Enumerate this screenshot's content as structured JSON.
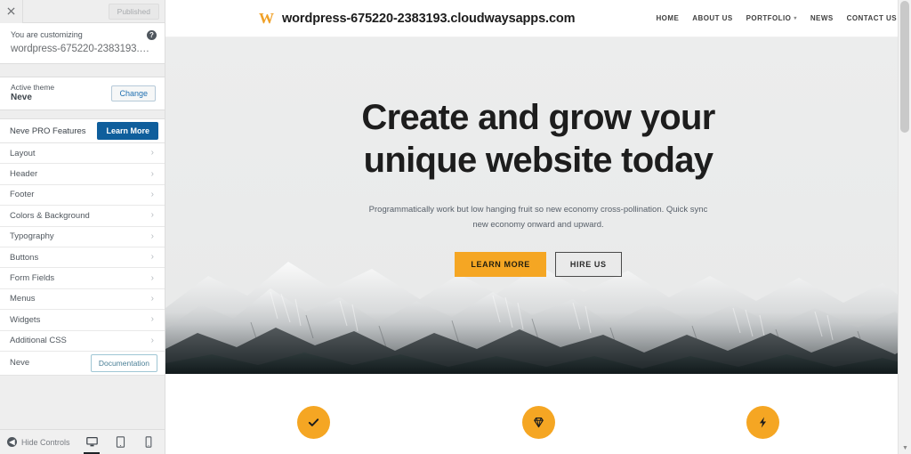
{
  "customizer": {
    "close_icon": "close-x-icon",
    "publish_button": "Published",
    "customizing_label": "You are customizing",
    "site_url": "wordpress-675220-2383193.cloudw...",
    "help_icon": "?",
    "active_theme_label": "Active theme",
    "active_theme_name": "Neve",
    "change_button": "Change",
    "pro_features_label": "Neve PRO Features",
    "pro_learn_more": "Learn More",
    "panels": [
      {
        "label": "Layout"
      },
      {
        "label": "Header"
      },
      {
        "label": "Footer"
      },
      {
        "label": "Colors & Background"
      },
      {
        "label": "Typography"
      },
      {
        "label": "Buttons"
      },
      {
        "label": "Form Fields"
      },
      {
        "label": "Menus"
      },
      {
        "label": "Widgets"
      },
      {
        "label": "Additional CSS"
      }
    ],
    "theme_footer_label": "Neve",
    "documentation_button": "Documentation",
    "hide_controls_label": "Hide Controls",
    "hide_controls_icon": "◀",
    "devices": [
      {
        "name": "desktop",
        "icon": "desktop-icon",
        "active": true
      },
      {
        "name": "tablet",
        "icon": "tablet-icon",
        "active": false
      },
      {
        "name": "mobile",
        "icon": "mobile-icon",
        "active": false
      }
    ],
    "accent_blue": "#0f5e9c",
    "link_blue": "#2271b1"
  },
  "preview": {
    "brand": {
      "logo_glyph": "W",
      "logo_color": "#f0a128",
      "name": "wordpress-675220-2383193.cloudwaysapps.com"
    },
    "nav": [
      {
        "label": "HOME",
        "has_dropdown": false
      },
      {
        "label": "ABOUT US",
        "has_dropdown": false
      },
      {
        "label": "PORTFOLIO",
        "has_dropdown": true
      },
      {
        "label": "NEWS",
        "has_dropdown": false
      },
      {
        "label": "CONTACT US",
        "has_dropdown": false
      }
    ],
    "hero": {
      "title_line1": "Create and grow your",
      "title_line2": "unique website today",
      "subtitle": "Programmatically work but low hanging fruit so new economy cross-pollination. Quick sync new economy onward and upward.",
      "primary_button": "LEARN MORE",
      "secondary_button": "HIRE US",
      "accent_color": "#f5a623",
      "background_image": "snowy-mountain-range-photo"
    },
    "features": [
      {
        "icon": "check-icon",
        "glyph": "✔"
      },
      {
        "icon": "diamond-icon",
        "glyph": "♦"
      },
      {
        "icon": "lightning-bolt-icon",
        "glyph": "⚡"
      }
    ]
  },
  "scrollbar": {
    "up_arrow": "▲",
    "down_arrow": "▼"
  }
}
